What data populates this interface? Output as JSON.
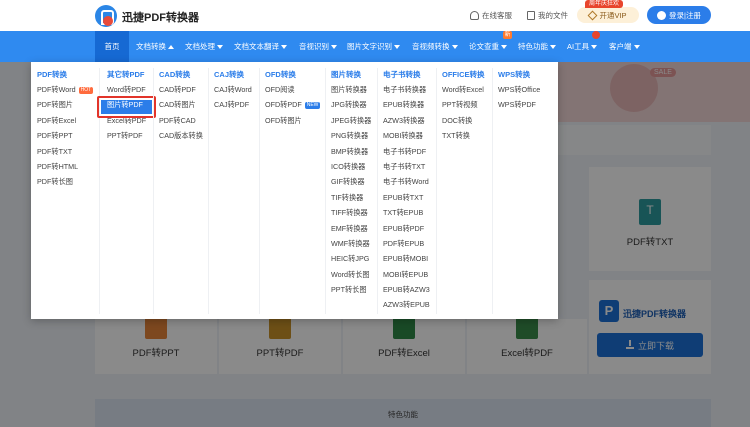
{
  "header": {
    "brand": "迅捷PDF转换器",
    "support": "在线客服",
    "my_files": "我的文件",
    "vip_button": "开通VIP",
    "vip_tag": "周年庆狂欢",
    "login": "登录|注册"
  },
  "nav": {
    "items": [
      "首页",
      "文档转换",
      "文档处理",
      "文档文本翻译",
      "音视识别",
      "图片文字识别",
      "音视频转换",
      "论文查重",
      "特色功能",
      "AI工具",
      "客户端"
    ],
    "new_badge": "新"
  },
  "dropdown": {
    "columns": [
      {
        "head": "PDF转换",
        "items": [
          "PDF转Word",
          "PDF转图片",
          "PDF转Excel",
          "PDF转PPT",
          "PDF转TXT",
          "PDF转HTML",
          "PDF转长图"
        ]
      },
      {
        "head": "其它转PDF",
        "items": [
          "Word转PDF",
          "图片转PDF",
          "Excel转PDF",
          "PPT转PDF"
        ]
      },
      {
        "head": "CAD转换",
        "items": [
          "CAD转PDF",
          "CAD转图片",
          "PDF转CAD",
          "CAD版本转换"
        ]
      },
      {
        "head": "CAJ转换",
        "items": [
          "CAJ转Word",
          "CAJ转PDF"
        ]
      },
      {
        "head": "OFD转换",
        "items": [
          "OFD阅读",
          "OFD转PDF",
          "OFD转图片"
        ]
      },
      {
        "head": "图片转换",
        "items": [
          "图片转换器",
          "JPG转换器",
          "JPEG转换器",
          "PNG转换器",
          "BMP转换器",
          "ICO转换器",
          "GIF转换器",
          "TIF转换器",
          "TIFF转换器",
          "EMF转换器",
          "WMF转换器",
          "HEIC转JPG",
          "Word转长图",
          "PPT转长图"
        ]
      },
      {
        "head": "电子书转换",
        "items": [
          "电子书转换器",
          "EPUB转换器",
          "AZW3转换器",
          "MOBI转换器",
          "电子书转PDF",
          "电子书转TXT",
          "电子书转Word",
          "EPUB转TXT",
          "TXT转EPUB",
          "EPUB转PDF",
          "PDF转EPUB",
          "EPUB转MOBI",
          "MOBI转EPUB",
          "EPUB转AZW3",
          "AZW3转EPUB"
        ]
      },
      {
        "head": "OFFICE转换",
        "items": [
          "Word转Excel",
          "PPT转视频",
          "DOC转换",
          "TXT转换"
        ]
      },
      {
        "head": "WPS转换",
        "items": [
          "WPS转Office",
          "WPS转PDF"
        ]
      }
    ],
    "hot_badge": "HOT",
    "new_badge": "NEW"
  },
  "content": {
    "banner_sale": "SALE",
    "cards": [
      "PDF转PPT",
      "PPT转PDF",
      "PDF转Excel",
      "Excel转PDF",
      "PDF转TXT"
    ],
    "promo_name": "迅捷PDF转换器",
    "download": "立即下载",
    "feature_title": "特色功能"
  }
}
